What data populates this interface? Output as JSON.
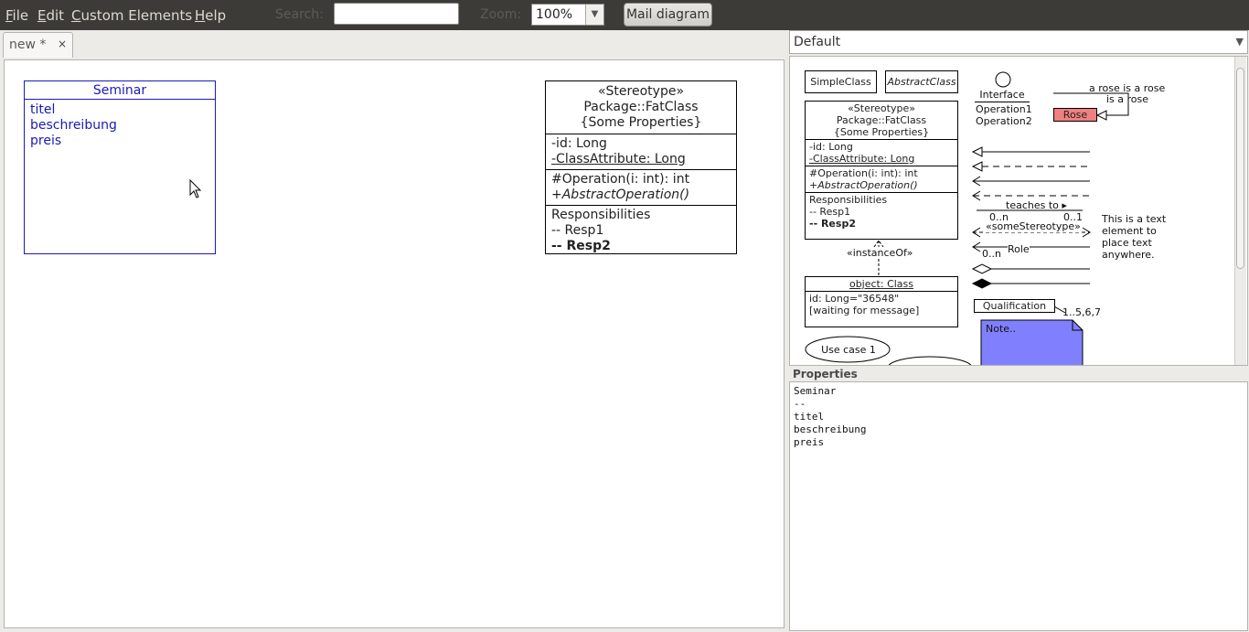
{
  "menubar": {
    "menus": [
      {
        "accel": "F",
        "rest": "ile"
      },
      {
        "accel": "E",
        "rest": "dit"
      },
      {
        "accel": "C",
        "rest": "ustom Elements"
      },
      {
        "accel": "H",
        "rest": "elp"
      }
    ],
    "search_label": "Search:",
    "zoom_label": "Zoom:",
    "zoom_value": "100%",
    "mail_button": "Mail diagram"
  },
  "tab": {
    "title": "new *",
    "close": "×"
  },
  "diagram": {
    "seminar": {
      "name": "Seminar",
      "attributes": [
        "titel",
        "beschreibung",
        "preis"
      ]
    },
    "fatclass": {
      "stereotype": "«Stereotype»",
      "name": "Package::FatClass",
      "props": "{Some Properties}",
      "attr1": "-id: Long",
      "attr2": "-ClassAttribute: Long",
      "op1": "#Operation(i: int): int",
      "op2": "+AbstractOperation()",
      "resp_title": "Responsibilities",
      "resp1": "-- Resp1",
      "resp2": "-- Resp2"
    }
  },
  "palette": {
    "selected": "Default",
    "simple_class": "SimpleClass",
    "abstract_class": "AbstractClass",
    "interface": "Interface",
    "op1": "Operation1",
    "op2": "Operation2",
    "rose_note": "a rose is a rose",
    "rose_note2": "is a rose",
    "rose": "Rose",
    "fat_stereo": "«Stereotype»",
    "fat_name": "Package::FatClass",
    "fat_props": "{Some Properties}",
    "fat_attr1": "-id: Long",
    "fat_attr2": "-ClassAttribute: Long",
    "fat_op1": "#Operation(i: int): int",
    "fat_op2": "+AbstractOperation()",
    "fat_resp": "Responsibilities",
    "fat_resp1": "-- Resp1",
    "fat_resp2": "-- Resp2",
    "instance_of": "«instanceOf»",
    "object_name": "object: Class",
    "object_attr": "id: Long=\"36548\"",
    "object_msg": "[waiting for message]",
    "teaches": "teaches to ▸",
    "mult1": "0..n",
    "mult2": "0..1",
    "some_stereo": "«someStereotype»",
    "role": "Role",
    "mult3": "0..n",
    "text_element": [
      "This is a text",
      "element to",
      "place text",
      "anywhere."
    ],
    "qualification": "Qualification",
    "qual_mult": "1..5,6,7",
    "note": "Note..",
    "usecase": "Use case 1"
  },
  "properties": {
    "label": "Properties",
    "lines": [
      "Seminar",
      "--",
      "titel",
      "beschreibung",
      "preis"
    ]
  },
  "colors": {
    "menubar": "#3c3b37",
    "seminar_blue": "#1a1ab8",
    "rose_fill": "#f08080",
    "note_fill": "#8080ff"
  }
}
